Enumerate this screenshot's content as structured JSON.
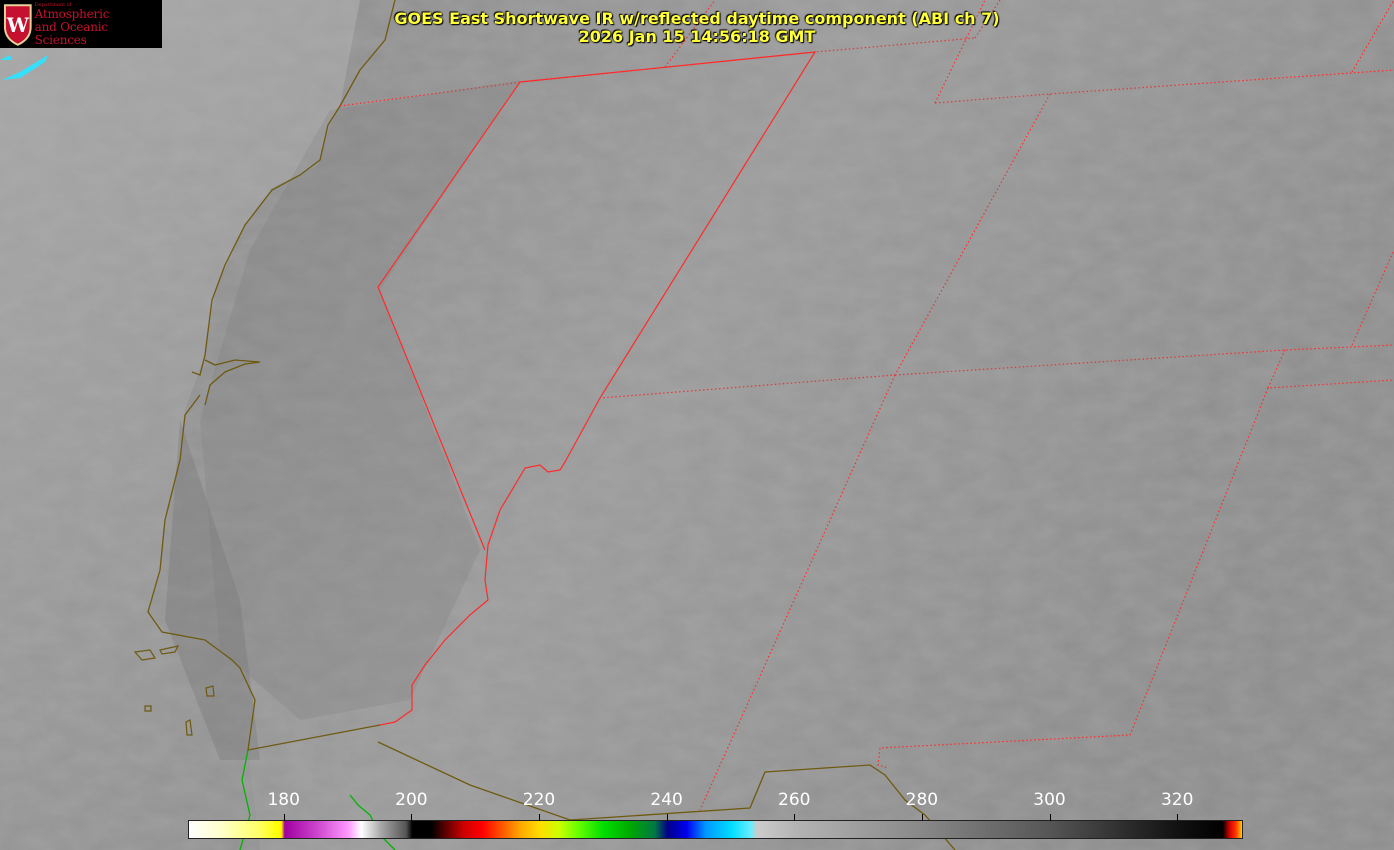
{
  "header": {
    "title": "GOES East Shortwave IR w/reflected daytime component (ABI ch 7)",
    "timestamp": "2026 Jan 15 14:56:18 GMT"
  },
  "logo": {
    "icon": "uw-crest-icon",
    "crest_letter": "W",
    "dept_line": "Department of",
    "line1": "Atmospheric",
    "line2": "and Oceanic Sciences",
    "color": "#c5112f"
  },
  "colorbar": {
    "ticks": [
      "180",
      "200",
      "220",
      "240",
      "260",
      "280",
      "300",
      "320"
    ],
    "range": [
      165,
      330
    ]
  },
  "colors": {
    "borders": "#ff2a2a",
    "coastline": "#6e5a10",
    "coastline_green": "#00b400",
    "title": "#ffff3a"
  }
}
